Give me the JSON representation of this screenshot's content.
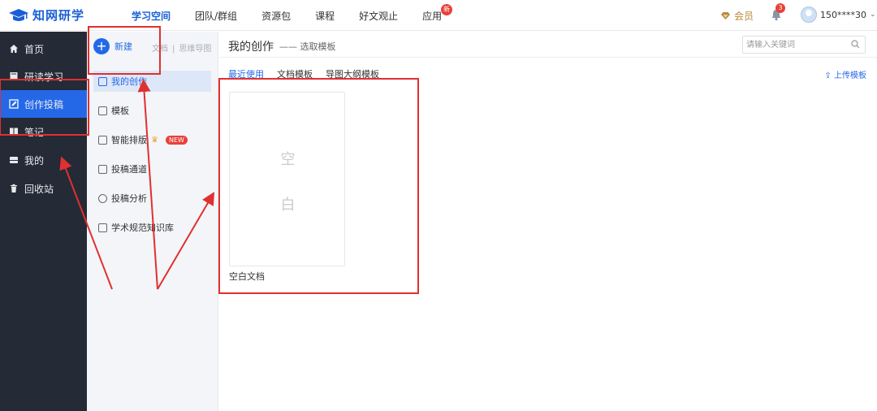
{
  "app": {
    "logo_text": "知网研学"
  },
  "topnav": {
    "items": [
      {
        "label": "学习空间",
        "active": true
      },
      {
        "label": "团队/群组",
        "active": false
      },
      {
        "label": "资源包",
        "active": false
      },
      {
        "label": "课程",
        "active": false
      },
      {
        "label": "好文观止",
        "active": false
      },
      {
        "label": "应用",
        "active": false,
        "badge": "新"
      }
    ],
    "vip_label": "会员",
    "notification_count": "3",
    "user_name": "150****30"
  },
  "sidebar": {
    "items": [
      {
        "label": "首页",
        "icon": "home-icon"
      },
      {
        "label": "研读学习",
        "icon": "book-icon"
      },
      {
        "label": "创作投稿",
        "icon": "edit-icon",
        "active": true
      },
      {
        "label": "笔记",
        "icon": "notebook-icon"
      },
      {
        "label": "我的",
        "icon": "drawer-icon"
      },
      {
        "label": "回收站",
        "icon": "trash-icon"
      }
    ]
  },
  "col2": {
    "new_label": "新建",
    "new_options": [
      "文档",
      "思维导图"
    ],
    "items": [
      {
        "label": "我的创作",
        "active": true
      },
      {
        "label": "模板"
      },
      {
        "label": "智能排版",
        "tag": "NEW"
      },
      {
        "label": "投稿通道"
      },
      {
        "label": "投稿分析"
      },
      {
        "label": "学术规范知识库"
      }
    ]
  },
  "main": {
    "title": "我的创作",
    "subtitle": "—— 选取模板",
    "search_placeholder": "请输入关键词",
    "tabs": [
      {
        "label": "最近使用",
        "active": true
      },
      {
        "label": "文档模板"
      },
      {
        "label": "导图大纲模板"
      }
    ],
    "upload_label": "上传模板",
    "card": {
      "chars": [
        "空",
        "白"
      ],
      "caption": "空白文档"
    }
  },
  "colors": {
    "accent": "#2468e8",
    "sidebar_bg": "#242a36",
    "annotation_red": "#e03030"
  }
}
